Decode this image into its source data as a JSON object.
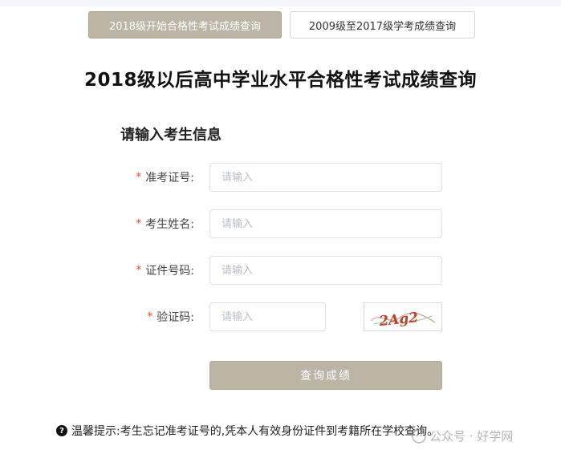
{
  "tabs": [
    {
      "label": "2018级开始合格性考试成绩查询",
      "active": true
    },
    {
      "label": "2009级至2017级学考成绩查询",
      "active": false
    }
  ],
  "title": "2018级以后高中学业水平合格性考试成绩查询",
  "form": {
    "heading": "请输入考生信息",
    "required_mark": "*",
    "fields": [
      {
        "label": "准考证号:",
        "placeholder": "请输入",
        "value": ""
      },
      {
        "label": "考生姓名:",
        "placeholder": "请输入",
        "value": ""
      },
      {
        "label": "证件号码:",
        "placeholder": "请输入",
        "value": ""
      },
      {
        "label": "验证码:",
        "placeholder": "请输入",
        "value": ""
      }
    ],
    "captcha_text": "2Ag2",
    "submit_label": "查询成绩"
  },
  "tip": {
    "icon": "question-circle-icon",
    "text": "温馨提示:考生忘记准考证号的,凭本人有效身份证件到考籍所在学校查询。"
  },
  "watermark": {
    "text": "公众号 · 好学网"
  },
  "colors": {
    "accent": "#bcb5a6",
    "required": "#e0513a",
    "border": "#dcdfe6"
  }
}
